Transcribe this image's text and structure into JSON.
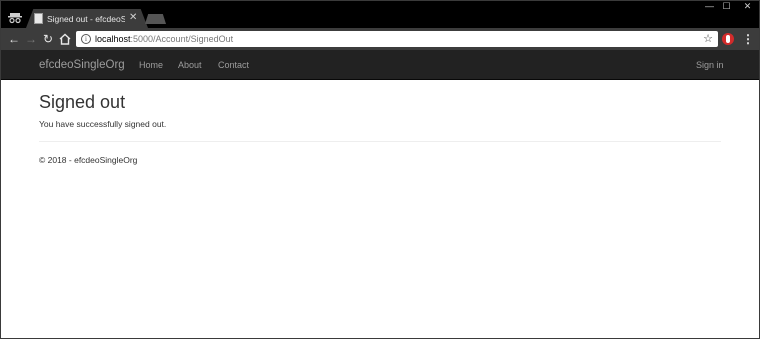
{
  "browser": {
    "tab": {
      "title": "Signed out - efcdeoSingleOrg"
    },
    "window_controls": {
      "minimize": "—",
      "maximize": "☐",
      "close": "✕"
    },
    "address_bar": {
      "host": "localhost",
      "path": ":5000/Account/SignedOut"
    }
  },
  "site": {
    "brand": "efcdeoSingleOrg",
    "nav": {
      "home": "Home",
      "about": "About",
      "contact": "Contact",
      "sign_in": "Sign in"
    }
  },
  "main": {
    "title": "Signed out",
    "message": "You have successfully signed out."
  },
  "footer": {
    "text": "© 2018 - efcdeoSingleOrg"
  }
}
